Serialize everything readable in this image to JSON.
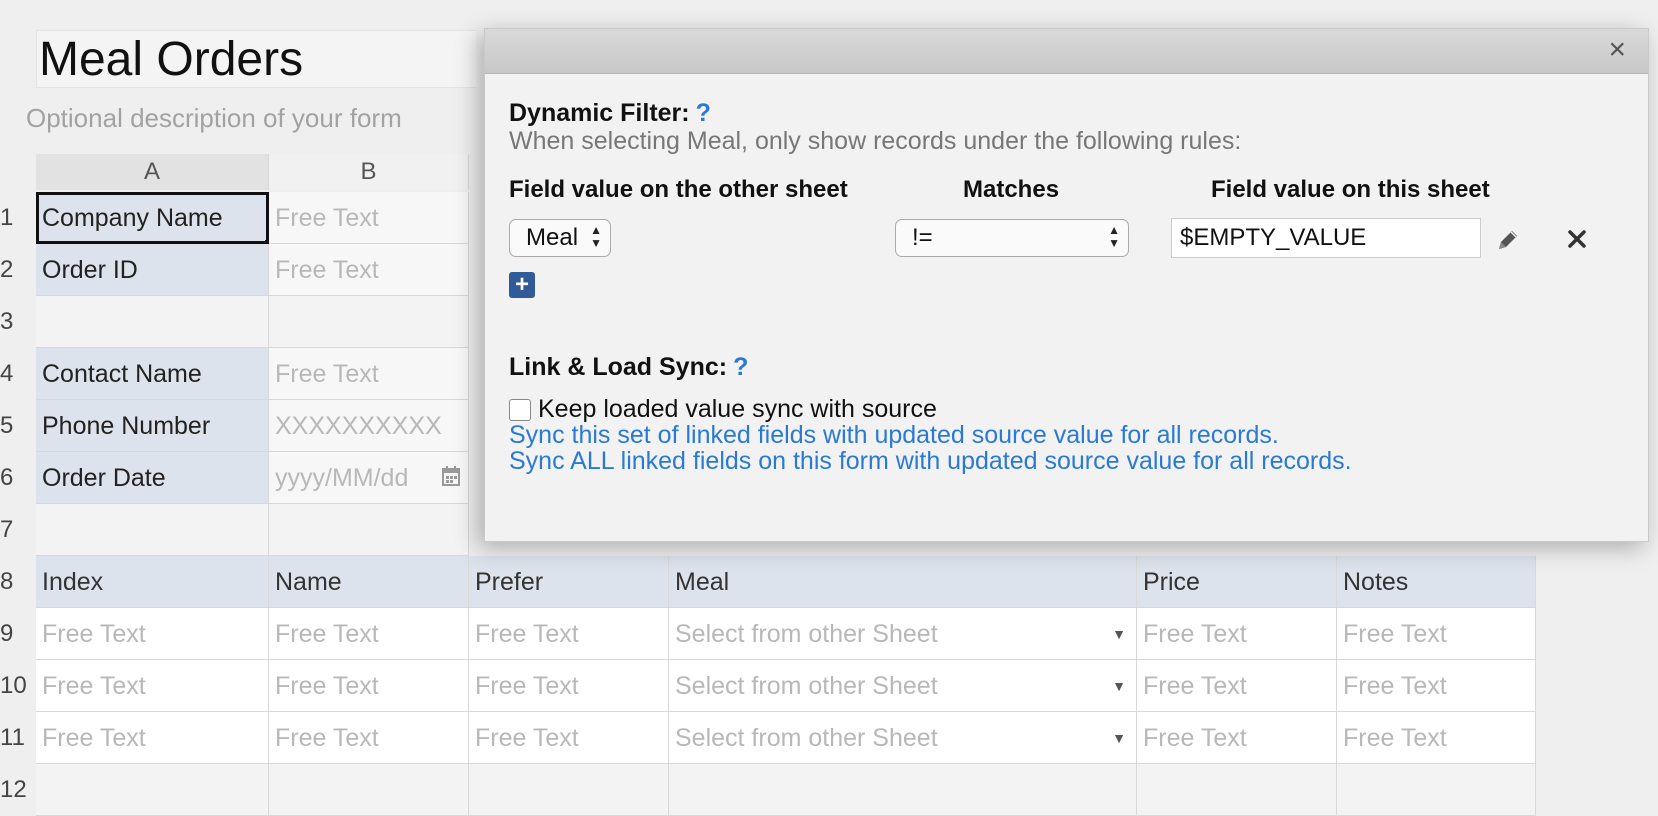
{
  "form": {
    "title": "Meal Orders",
    "description_placeholder": "Optional description of your form"
  },
  "columns": [
    "A",
    "B"
  ],
  "rows": [
    {
      "num": "1",
      "label": "Company Name",
      "value": "Free Text"
    },
    {
      "num": "2",
      "label": "Order ID",
      "value": "Free Text"
    },
    {
      "num": "3",
      "label": "",
      "value": ""
    },
    {
      "num": "4",
      "label": "Contact Name",
      "value": "Free Text"
    },
    {
      "num": "5",
      "label": "Phone Number",
      "value": "XXXXXXXXXX"
    },
    {
      "num": "6",
      "label": "Order Date",
      "value": "yyyy/MM/dd"
    },
    {
      "num": "7",
      "label": "",
      "value": ""
    }
  ],
  "table": {
    "header_row_num": "8",
    "headers": [
      "Index",
      "Name",
      "Prefer",
      "Meal",
      "Price",
      "Notes"
    ],
    "body_rows": [
      {
        "num": "9",
        "cells": [
          "Free Text",
          "Free Text",
          "Free Text",
          "Select from other Sheet",
          "Free Text",
          "Free Text"
        ]
      },
      {
        "num": "10",
        "cells": [
          "Free Text",
          "Free Text",
          "Free Text",
          "Select from other Sheet",
          "Free Text",
          "Free Text"
        ]
      },
      {
        "num": "11",
        "cells": [
          "Free Text",
          "Free Text",
          "Free Text",
          "Select from other Sheet",
          "Free Text",
          "Free Text"
        ]
      }
    ],
    "last_row_num": "12"
  },
  "modal": {
    "close_glyph": "×",
    "dynamic_filter": {
      "title": "Dynamic Filter:",
      "help": "?",
      "subtitle": "When selecting Meal, only show records under the following rules:",
      "col_other": "Field value on the other sheet",
      "col_matches": "Matches",
      "col_this": "Field value on this sheet",
      "rule": {
        "field": "Meal",
        "operator": "!=",
        "value": "$EMPTY_VALUE"
      },
      "add_glyph": "+"
    },
    "link_load_sync": {
      "title": "Link & Load Sync:",
      "help": "?",
      "checkbox_label": "Keep loaded value sync with source",
      "checkbox_checked": false,
      "link1": "Sync this set of linked fields with updated source value for all records.",
      "link2": "Sync ALL linked fields on this form with updated source value for all records."
    }
  },
  "colors": {
    "accent_blue": "#2a7ad3",
    "label_bg": "#dde3ec",
    "plus_bg": "#2f5b99"
  }
}
